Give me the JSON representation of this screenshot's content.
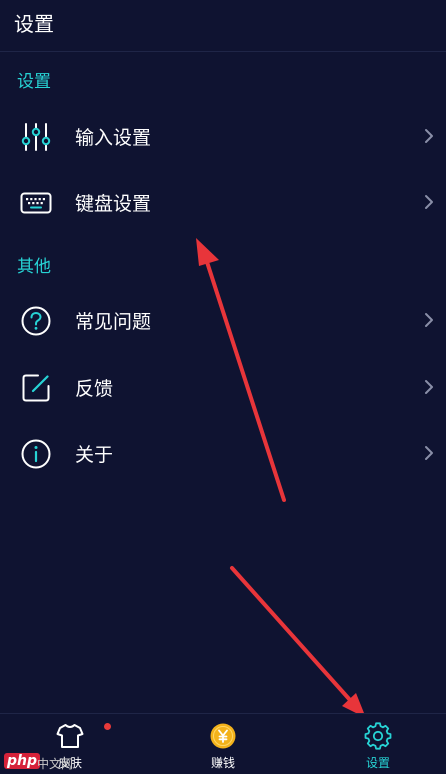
{
  "header": {
    "title": "设置"
  },
  "sections": {
    "settings_label": "设置",
    "other_label": "其他"
  },
  "rows": {
    "input_settings": "输入设置",
    "keyboard_settings": "键盘设置",
    "faq": "常见问题",
    "feedback": "反馈",
    "about": "关于"
  },
  "tabbar": {
    "skin": "皮肤",
    "earn": "赚钱",
    "settings": "设置",
    "active_tab": "settings"
  },
  "watermark": {
    "brand": "php",
    "site": "中文网"
  },
  "colors": {
    "background": "#0f1331",
    "accent": "#27d3d5",
    "text": "#ffffff",
    "chevron": "#8a8fa8",
    "badge": "#e83a3a",
    "coin": "#f3b21b",
    "annotation_arrow": "#e8353a"
  },
  "icons": {
    "input_settings": "sliders-icon",
    "keyboard_settings": "keyboard-icon",
    "faq": "question-circle-icon",
    "feedback": "edit-square-icon",
    "about": "info-circle-icon",
    "skin": "tshirt-icon",
    "earn": "yuan-coin-icon",
    "settings": "gear-icon"
  }
}
